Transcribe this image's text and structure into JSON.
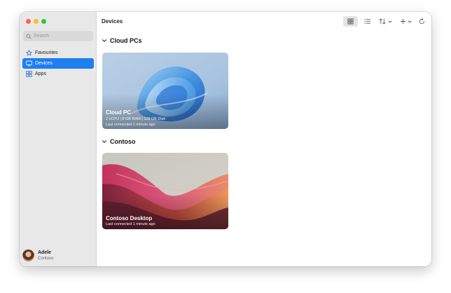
{
  "sidebar": {
    "search_placeholder": "Search",
    "items": [
      {
        "label": "Favourites",
        "icon": "star-icon",
        "active": false
      },
      {
        "label": "Devices",
        "icon": "monitor-icon",
        "active": true
      },
      {
        "label": "Apps",
        "icon": "apps-grid-icon",
        "active": false
      }
    ],
    "user": {
      "name": "Adele",
      "org": "Contoso"
    }
  },
  "header": {
    "title": "Devices",
    "toolbar_icons": [
      "grid-view-icon",
      "list-view-icon",
      "sort-icon",
      "add-icon",
      "refresh-icon"
    ]
  },
  "sections": [
    {
      "label": "Cloud PCs",
      "cards": [
        {
          "title": "Cloud PC",
          "specs": "2 vCPU | 8 GB RAM | 128 GB Disk",
          "status": "Last connected 1 minute ago"
        }
      ]
    },
    {
      "label": "Contoso",
      "cards": [
        {
          "title": "Contoso Desktop",
          "status": "Last connected 1 minute ago"
        }
      ]
    }
  ],
  "colors": {
    "accent": "#1f7ef0",
    "sidebar_bg": "#e8e8e8"
  }
}
